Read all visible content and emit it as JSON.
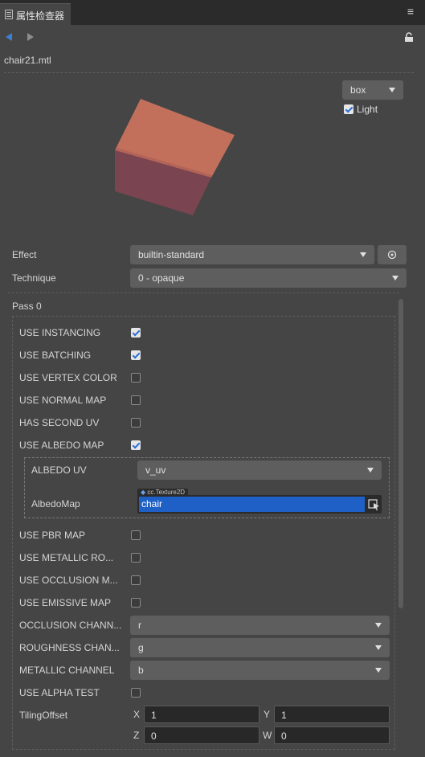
{
  "panel": {
    "tab_title": "属性检查器",
    "filename": "chair21.mtl"
  },
  "preview": {
    "shape": "box",
    "light_label": "Light",
    "light_checked": true
  },
  "effect": {
    "label": "Effect",
    "value": "builtin-standard"
  },
  "technique": {
    "label": "Technique",
    "value": "0 - opaque"
  },
  "pass": {
    "title": "Pass 0",
    "flags": [
      {
        "label": "USE INSTANCING",
        "checked": true
      },
      {
        "label": "USE BATCHING",
        "checked": true
      },
      {
        "label": "USE VERTEX COLOR",
        "checked": false
      },
      {
        "label": "USE NORMAL MAP",
        "checked": false
      },
      {
        "label": "HAS SECOND UV",
        "checked": false
      },
      {
        "label": "USE ALBEDO MAP",
        "checked": true
      }
    ],
    "albedo_uv": {
      "label": "ALBEDO UV",
      "value": "v_uv"
    },
    "albedo_map": {
      "label": "AlbedoMap",
      "type_tag": "cc.Texture2D",
      "value": "chair"
    },
    "flags2": [
      {
        "label": "USE PBR MAP",
        "checked": false
      },
      {
        "label": "USE METALLIC RO...",
        "checked": false
      },
      {
        "label": "USE OCCLUSION M...",
        "checked": false
      },
      {
        "label": "USE EMISSIVE MAP",
        "checked": false
      }
    ],
    "channels": [
      {
        "label": "OCCLUSION CHANN...",
        "value": "r"
      },
      {
        "label": "ROUGHNESS CHAN...",
        "value": "g"
      },
      {
        "label": "METALLIC CHANNEL",
        "value": "b"
      }
    ],
    "alpha_test": {
      "label": "USE ALPHA TEST",
      "checked": false
    },
    "tiling": {
      "label": "TilingOffset",
      "x_label": "X",
      "x": "1",
      "y_label": "Y",
      "y": "1",
      "z_label": "Z",
      "z": "0",
      "w_label": "W",
      "w": "0"
    }
  },
  "colors": {
    "panel_bg": "#454545",
    "accent_blue": "#1f60c6",
    "cube_top": "#c2705c",
    "cube_side": "#7a4450"
  }
}
